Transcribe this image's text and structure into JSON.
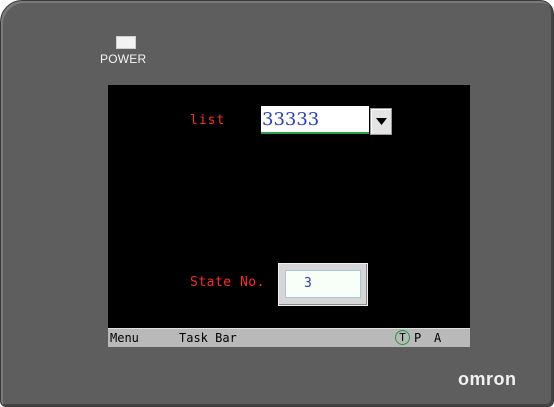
{
  "device": {
    "power_label": "POWER",
    "brand": "omron"
  },
  "screen": {
    "list": {
      "label": "list",
      "value": "33333"
    },
    "state": {
      "label": "State No.",
      "value": "3"
    },
    "taskbar": {
      "menu": "Menu",
      "task_bar": "Task Bar",
      "t": "T",
      "p": "P",
      "a": "A"
    }
  },
  "colors": {
    "screen_bg": "#000000",
    "label_red": "#ff2a2a",
    "value_blue": "#2a3fbf",
    "bezel": "#5e5e5e",
    "taskbar": "#b9b9b9"
  }
}
